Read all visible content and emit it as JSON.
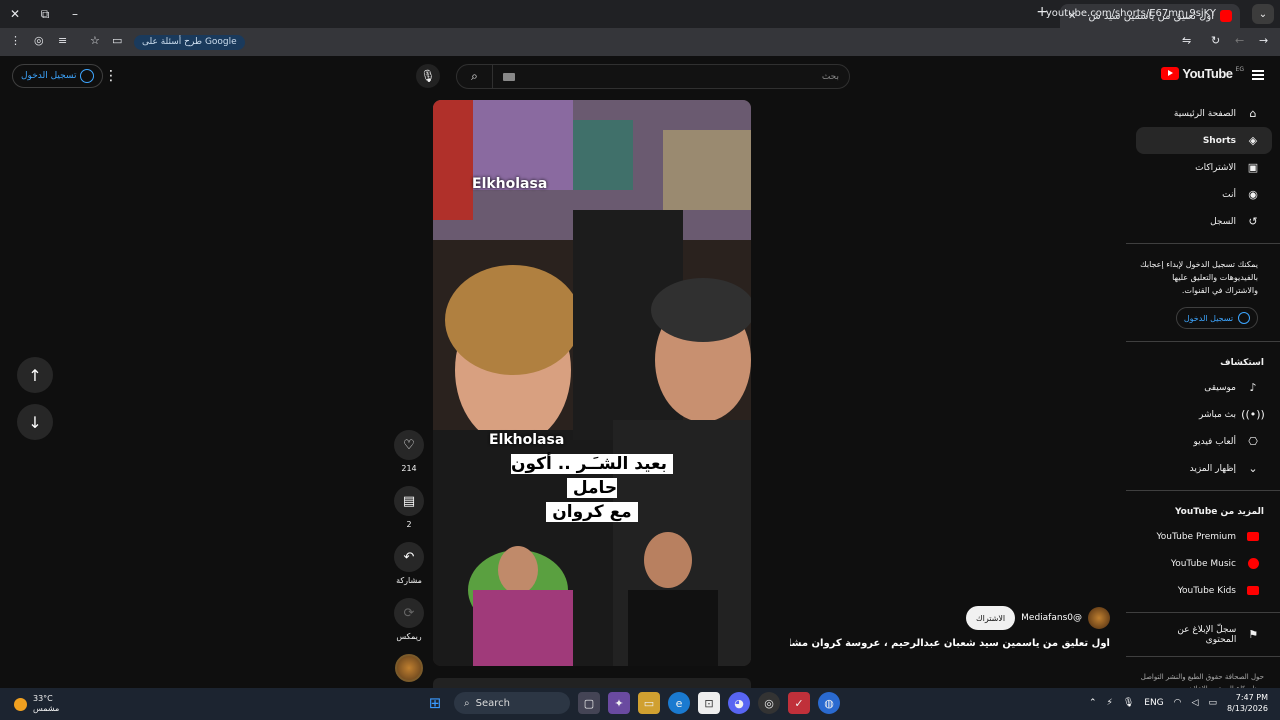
{
  "browser": {
    "tab_title": "أول تعليق من ياسمين سيد ش",
    "url": "youtube.com/shorts/E67mn_9sjKY",
    "google_pill": "طرح أسئلة على Google"
  },
  "header": {
    "signin_label": "تسجيل الدخول",
    "search_placeholder": "بحث",
    "logo_text": "YouTube",
    "logo_region": "EG"
  },
  "sidebar": {
    "items": [
      {
        "label": "الصفحة الرئيسية",
        "icon": "home-icon"
      },
      {
        "label": "Shorts",
        "icon": "shorts-icon"
      },
      {
        "label": "الاشتراكات",
        "icon": "subscriptions-icon"
      },
      {
        "label": "أنت",
        "icon": "you-icon"
      },
      {
        "label": "السجل",
        "icon": "history-icon"
      }
    ],
    "signin_note": "يمكنك تسجيل الدخول لإبداء إعجابك بالفيديوهات والتعليق عليها والاشتراك في القنوات.",
    "signin_button": "تسجيل الدخول",
    "explore_title": "استكشاف",
    "explore": [
      {
        "label": "موسيقى",
        "icon": "music-icon"
      },
      {
        "label": "بث مباشر",
        "icon": "live-icon"
      },
      {
        "label": "ألعاب فيديو",
        "icon": "gaming-icon"
      },
      {
        "label": "إظهار المزيد",
        "icon": "chevron-down-icon"
      }
    ],
    "more_title": "المزيد من YouTube",
    "more": [
      {
        "label": "YouTube Premium"
      },
      {
        "label": "YouTube Music"
      },
      {
        "label": "YouTube Kids"
      }
    ],
    "report": "سجلّ الإبلاغ عن المحتوى",
    "footer": "حول  الصحافة  حقوق الطبع والنشر  التواصل معنا  صنّاع المحتوى  الإعلان"
  },
  "short": {
    "watermark": "Elkholasa",
    "caption_line1": "بعيد الشـَـر .. أكون حامل",
    "caption_line2": "مع كروان",
    "likes": "214",
    "comments": "2",
    "share": "مشاركة",
    "remix": "ريمكس",
    "channel": "@Mediafans0",
    "subscribe": "الاشتراك",
    "title": "أول تعليق من ياسمين سيد شعبان عبدالرحيم ، عروسة كروان مشاكل، عـ..."
  },
  "taskbar": {
    "temp": "33°C",
    "weather": "مشمس",
    "search": "Search",
    "lang": "ENG",
    "time": "7:47 PM",
    "date": "8/13/2026"
  }
}
